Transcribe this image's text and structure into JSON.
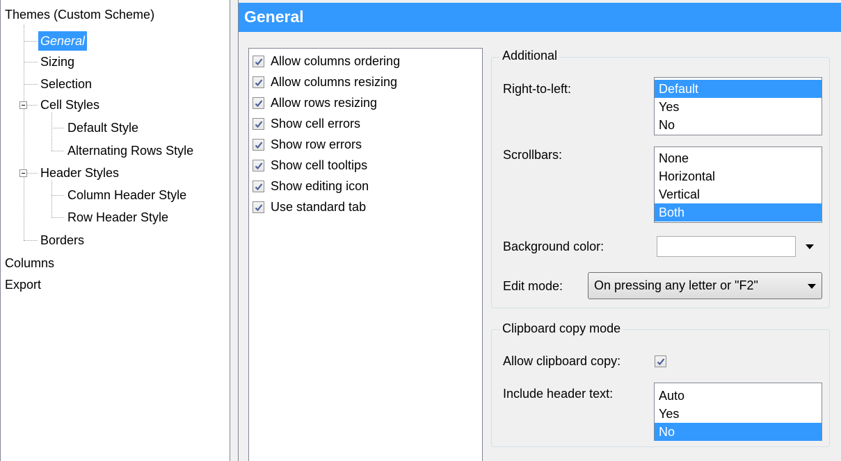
{
  "tree": {
    "items": [
      {
        "label": "Themes (Custom Scheme)"
      },
      {
        "label": "General"
      },
      {
        "label": "Sizing"
      },
      {
        "label": "Selection"
      },
      {
        "label": "Cell Styles"
      },
      {
        "label": "Default Style"
      },
      {
        "label": "Alternating Rows Style"
      },
      {
        "label": "Header Styles"
      },
      {
        "label": "Column Header Style"
      },
      {
        "label": "Row Header Style"
      },
      {
        "label": "Borders"
      },
      {
        "label": "Columns"
      },
      {
        "label": "Export"
      }
    ]
  },
  "header": {
    "title": "General"
  },
  "options": [
    {
      "label": "Allow columns ordering",
      "checked": true
    },
    {
      "label": "Allow columns resizing",
      "checked": true
    },
    {
      "label": "Allow rows resizing",
      "checked": true
    },
    {
      "label": "Show cell errors",
      "checked": true
    },
    {
      "label": "Show row errors",
      "checked": true
    },
    {
      "label": "Show cell tooltips",
      "checked": true
    },
    {
      "label": "Show editing icon",
      "checked": true
    },
    {
      "label": "Use standard tab",
      "checked": true
    }
  ],
  "additional": {
    "title": "Additional",
    "rtl_label": "Right-to-left:",
    "rtl_options": [
      "Default",
      "Yes",
      "No"
    ],
    "rtl_selected": "Default",
    "scroll_label": "Scrollbars:",
    "scroll_options": [
      "None",
      "Horizontal",
      "Vertical",
      "Both"
    ],
    "scroll_selected": "Both",
    "bg_label": "Background color:",
    "bg_value": "",
    "edit_label": "Edit mode:",
    "edit_value": "On pressing any letter or \"F2\""
  },
  "clipboard": {
    "title": "Clipboard copy mode",
    "allow_label": "Allow clipboard copy:",
    "allow_checked": true,
    "header_label": "Include header text:",
    "header_options": [
      "Auto",
      "Yes",
      "No"
    ],
    "header_selected": "No"
  },
  "colors": {
    "accent": "#3399ff"
  }
}
